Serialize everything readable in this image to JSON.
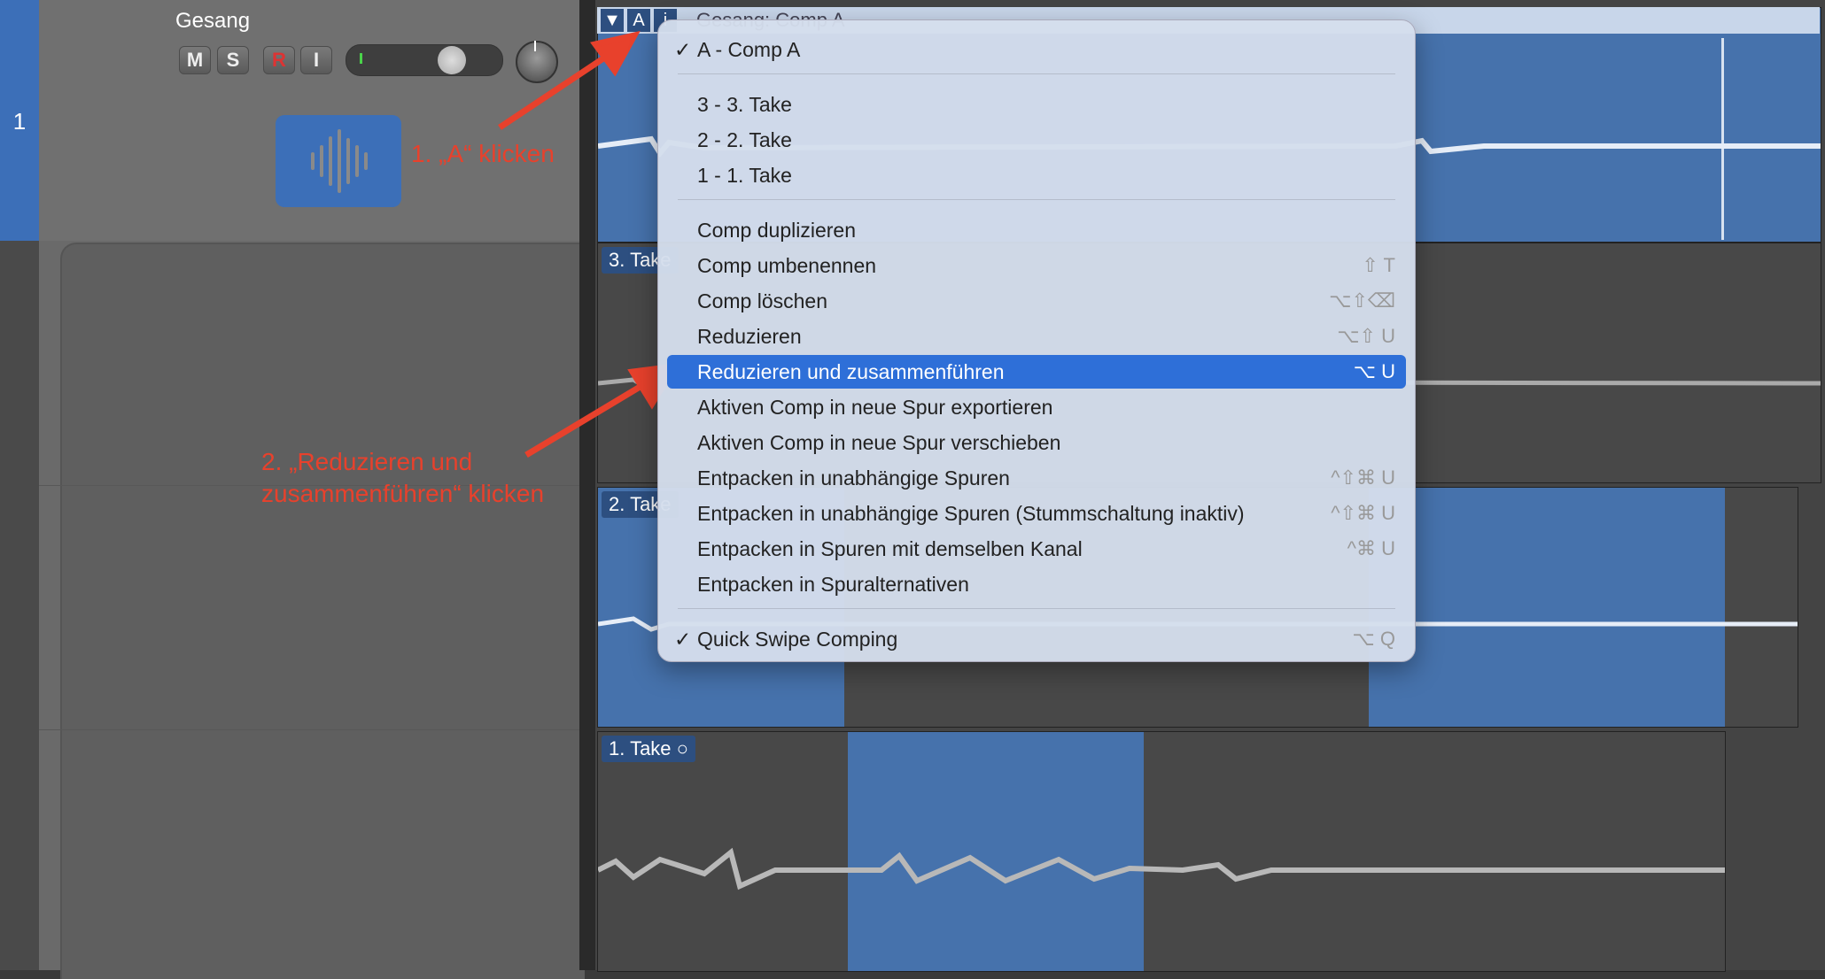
{
  "track": {
    "number": "1",
    "name": "Gesang",
    "buttons": {
      "mute": "M",
      "solo": "S",
      "record": "R",
      "input": "I"
    }
  },
  "annotations": {
    "step1": "1. „A“ klicken",
    "step2_line1": "2. „Reduzieren und",
    "step2_line2": "zusammenführen“ klicken"
  },
  "comp_header": {
    "title": "Gesang: Comp A",
    "buttons": [
      "▼",
      "A",
      "i"
    ]
  },
  "lanes": {
    "take3": "3. Take",
    "take2": "2. Take",
    "take1": "1. Take"
  },
  "menu": {
    "items": [
      {
        "label": "A - Comp A",
        "checked": "✓"
      },
      {
        "label": "3 - 3. Take"
      },
      {
        "label": "2 - 2. Take"
      },
      {
        "label": "1 - 1. Take"
      },
      {
        "label": "Comp duplizieren"
      },
      {
        "label": "Comp umbenennen",
        "shortcut": "⇧ T"
      },
      {
        "label": "Comp löschen",
        "shortcut": "⌥⇧⌫"
      },
      {
        "label": "Reduzieren",
        "shortcut": "⌥⇧ U"
      },
      {
        "label": "Reduzieren und zusammenführen",
        "shortcut": "⌥ U"
      },
      {
        "label": "Aktiven Comp in neue Spur exportieren"
      },
      {
        "label": "Aktiven Comp in neue Spur verschieben"
      },
      {
        "label": "Entpacken in unabhängige Spuren",
        "shortcut": "^⇧⌘ U"
      },
      {
        "label": "Entpacken in unabhängige Spuren (Stummschaltung inaktiv)",
        "shortcut": "^⇧⌘ U"
      },
      {
        "label": "Entpacken in Spuren mit demselben Kanal",
        "shortcut": "^⌘ U"
      },
      {
        "label": "Entpacken in Spuralternativen"
      },
      {
        "label": "Quick Swipe Comping",
        "shortcut": "⌥ Q",
        "checked": "✓"
      }
    ]
  },
  "colors": {
    "accent": "#2e6fd8",
    "annotation": "#e8412c",
    "region": "#4672ac"
  }
}
